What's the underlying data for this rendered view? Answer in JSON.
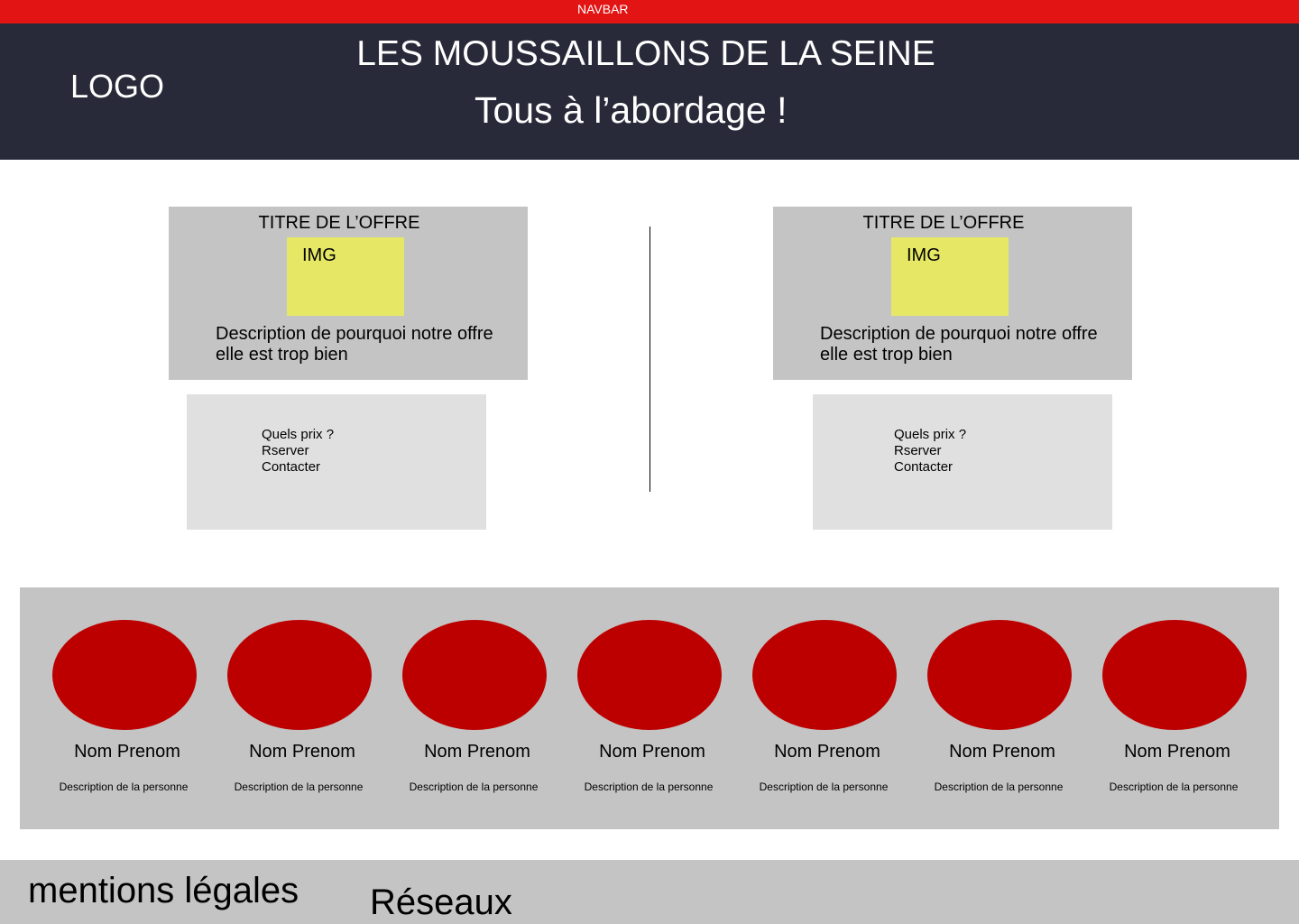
{
  "navbar": {
    "label": "NAVBAR"
  },
  "header": {
    "logo": "LOGO",
    "title": "LES MOUSSAILLONS DE LA SEINE",
    "subtitle": "Tous à l’abordage !"
  },
  "offers": [
    {
      "title": "TITRE DE L’OFFRE",
      "image_label": "IMG",
      "description": "Description de pourquoi notre offre elle est trop bien",
      "actions": [
        "Quels prix ?",
        "Rserver",
        "Contacter"
      ]
    },
    {
      "title": "TITRE DE L’OFFRE",
      "image_label": "IMG",
      "description": "Description de pourquoi notre offre elle est trop bien",
      "actions": [
        "Quels prix ?",
        "Rserver",
        "Contacter"
      ]
    }
  ],
  "team": {
    "members": [
      {
        "name": "Nom Prenom",
        "description": "Description de la personne"
      },
      {
        "name": "Nom Prenom",
        "description": "Description de la personne"
      },
      {
        "name": "Nom Prenom",
        "description": "Description de la personne"
      },
      {
        "name": "Nom Prenom",
        "description": "Description de la personne"
      },
      {
        "name": "Nom Prenom",
        "description": "Description de la personne"
      },
      {
        "name": "Nom Prenom",
        "description": "Description de la personne"
      },
      {
        "name": "Nom Prenom",
        "description": "Description de la personne"
      }
    ]
  },
  "footer": {
    "legal": "mentions légales",
    "social": "Réseaux"
  },
  "colors": {
    "navbar": "#e21414",
    "header": "#282a39",
    "card": "#c4c4c4",
    "actions": "#e0e0e0",
    "image_placeholder": "#e6e865",
    "avatar": "#bc0000"
  }
}
